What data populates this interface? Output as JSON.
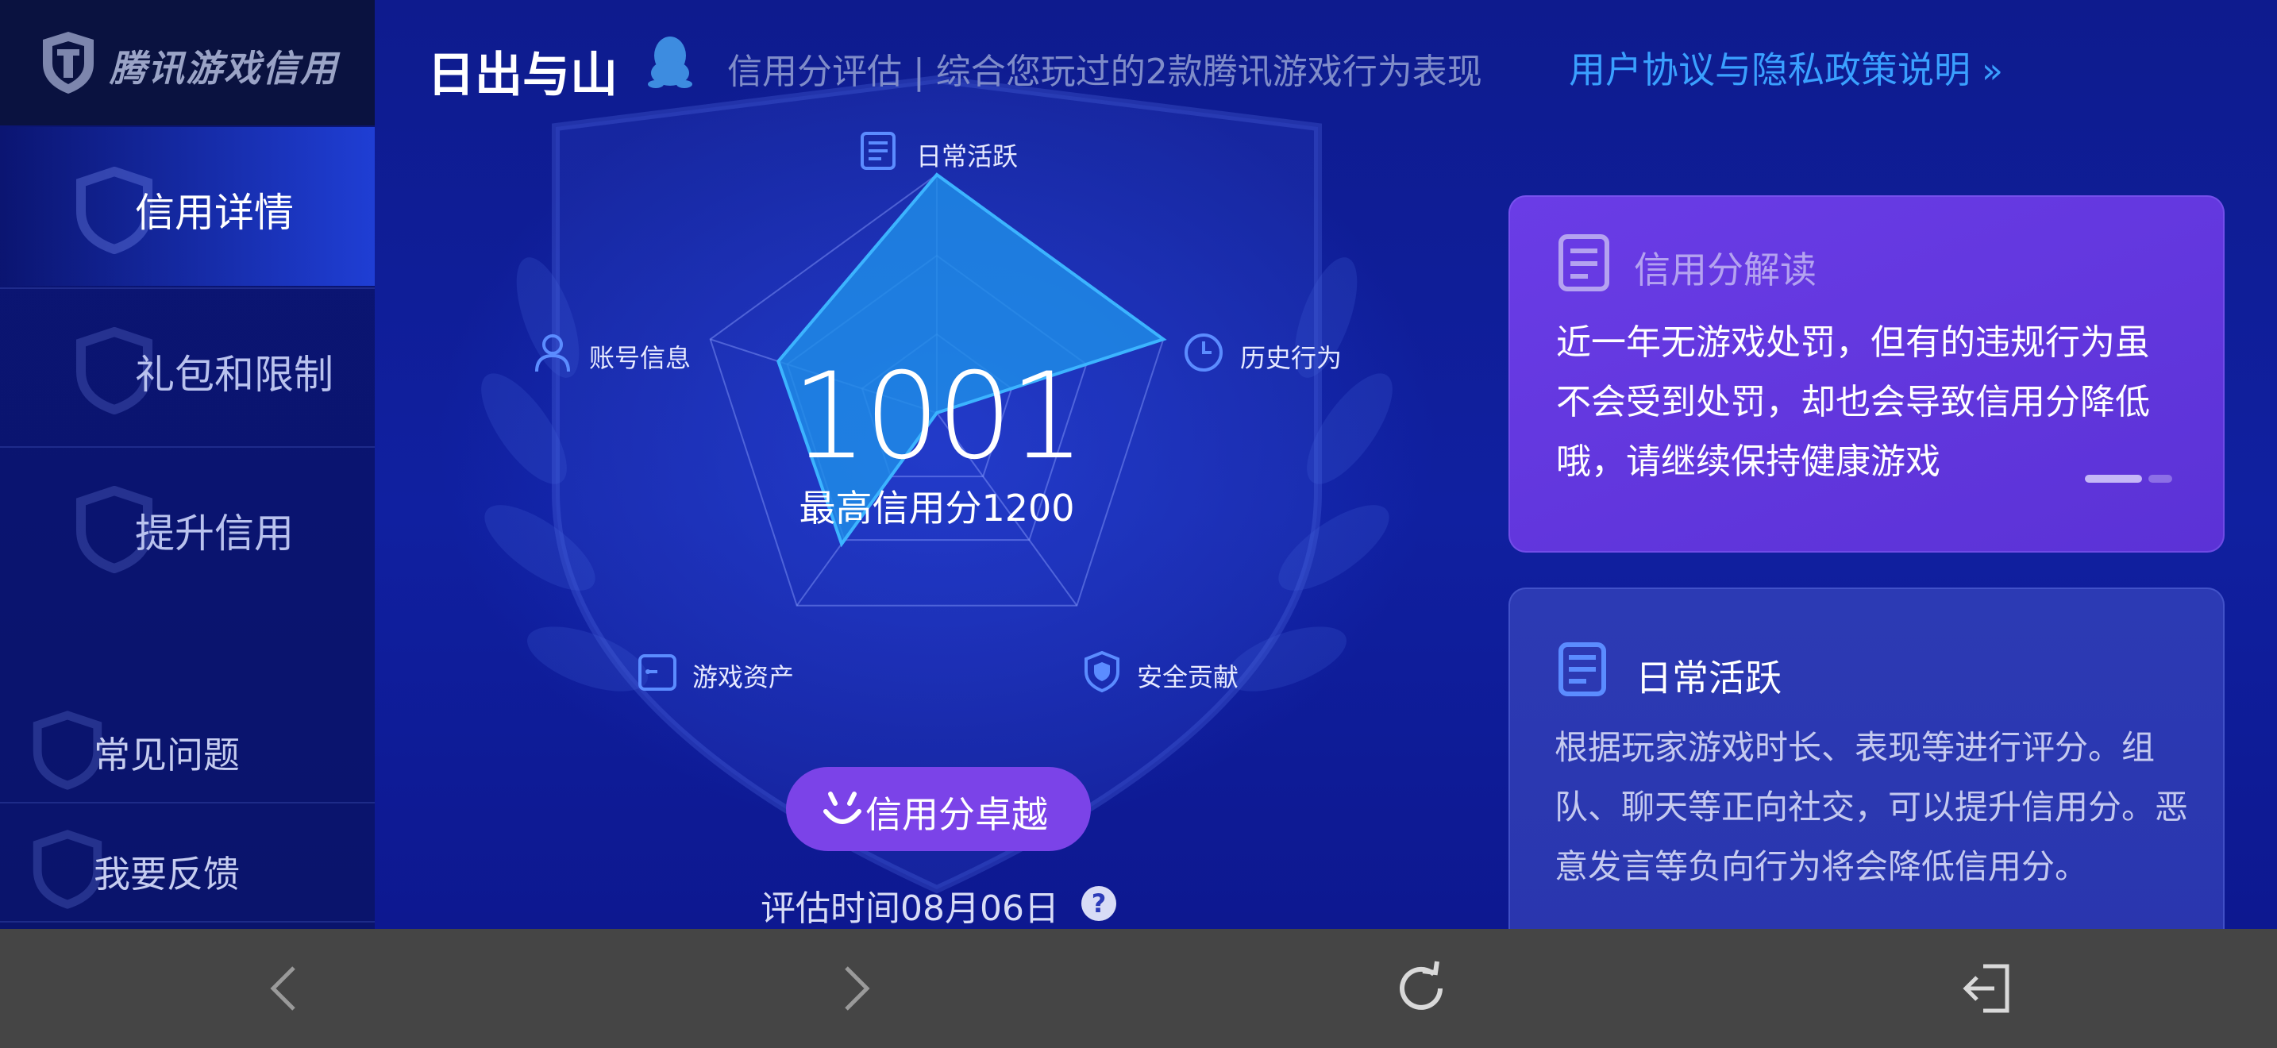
{
  "sidebar": {
    "logo_text": "腾讯游戏信用",
    "items": [
      {
        "label": "信用详情",
        "active": true
      },
      {
        "label": "礼包和限制",
        "active": false
      },
      {
        "label": "提升信用",
        "active": false
      }
    ],
    "faq_label": "常见问题",
    "feedback_label": "我要反馈"
  },
  "header": {
    "user_name": "日出与山",
    "description": "信用分评估 | 综合您玩过的2款腾讯游戏行为表现",
    "policy_link": "用户协议与隐私政策说明"
  },
  "radar": {
    "axes": [
      {
        "label": "日常活跃",
        "icon": "doc-icon",
        "value": 1.0
      },
      {
        "label": "历史行为",
        "icon": "clock-icon",
        "value": 1.0
      },
      {
        "label": "安全贡献",
        "icon": "shield-icon",
        "value": 0.0
      },
      {
        "label": "游戏资产",
        "icon": "wallet-icon",
        "value": 0.68
      },
      {
        "label": "账号信息",
        "icon": "user-icon",
        "value": 0.7
      }
    ],
    "score": "1001",
    "max_score": "最高信用分1200",
    "grade": "信用分卓越",
    "eval_time": "评估时间08月06日",
    "help_symbol": "?"
  },
  "cards": {
    "interpret": {
      "title": "信用分解读",
      "body": "近一年无游戏处罚，但有的违规行为虽不会受到处罚，却也会导致信用分降低哦，请继续保持健康游戏"
    },
    "daily": {
      "title": "日常活跃",
      "body": "根据玩家游戏时长、表现等进行评分。组队、聊天等正向社交，可以提升信用分。恶意发言等负向行为将会降低信用分。"
    }
  },
  "bottom_nav": {
    "back_icon": "chevron-left-icon",
    "forward_icon": "chevron-right-icon",
    "refresh_icon": "refresh-icon",
    "exit_icon": "exit-icon"
  },
  "colors": {
    "background": "#0e1b8e",
    "sidebar_active": "#1f3ed4",
    "radar_fill": "#1f8de8",
    "radar_stroke": "#3cb4ff",
    "link": "#3aa0ff",
    "grade_badge": "#7b43e8",
    "interpret_card": "#6a3ce6",
    "daily_card": "#2c3ab4",
    "bottom_nav": "#454545"
  }
}
